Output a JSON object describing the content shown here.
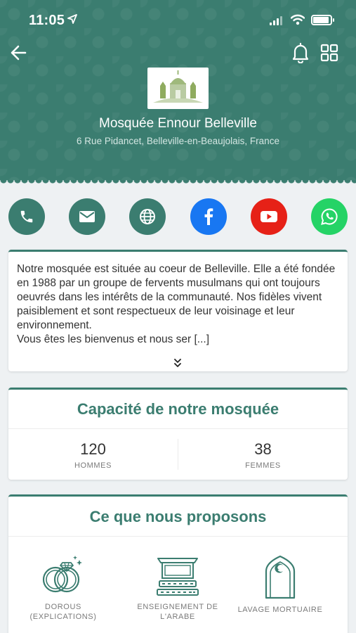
{
  "status_bar": {
    "time": "11:05"
  },
  "header": {
    "title": "Mosquée Ennour Belleville",
    "address": "6 Rue Pidancet, Belleville-en-Beaujolais, France"
  },
  "contacts": [
    {
      "icon": "phone-icon",
      "color": "#3b7d70"
    },
    {
      "icon": "mail-icon",
      "color": "#3b7d70"
    },
    {
      "icon": "globe-icon",
      "color": "#3b7d70"
    },
    {
      "icon": "facebook-icon",
      "color": "#1877f2"
    },
    {
      "icon": "youtube-icon",
      "color": "#e62117"
    },
    {
      "icon": "whatsapp-icon",
      "color": "#25d366"
    }
  ],
  "description": {
    "text": "Notre mosquée est située au coeur de Belleville. Elle a été fondée en 1988 par un groupe de fervents musulmans qui ont toujours oeuvrés dans les intérêts de la communauté. Nos fidèles vivent paisiblement et sont respectueux de leur voisinage et leur environnement.\nVous êtes les bienvenus et nous ser [...]"
  },
  "capacity": {
    "title": "Capacité de notre mosquée",
    "men_value": "120",
    "men_label": "HOMMES",
    "women_value": "38",
    "women_label": "FEMMES"
  },
  "services": {
    "title": "Ce que nous proposons",
    "items": [
      {
        "label": "DOROUS\n(EXPLICATIONS)",
        "icon": "rings-icon"
      },
      {
        "label": "ENSEIGNEMENT DE\nL'ARABE",
        "icon": "lectern-icon"
      },
      {
        "label": "LAVAGE MORTUAIRE",
        "icon": "crescent-arch-icon"
      }
    ]
  },
  "theme": {
    "primary": "#3b7d70"
  }
}
